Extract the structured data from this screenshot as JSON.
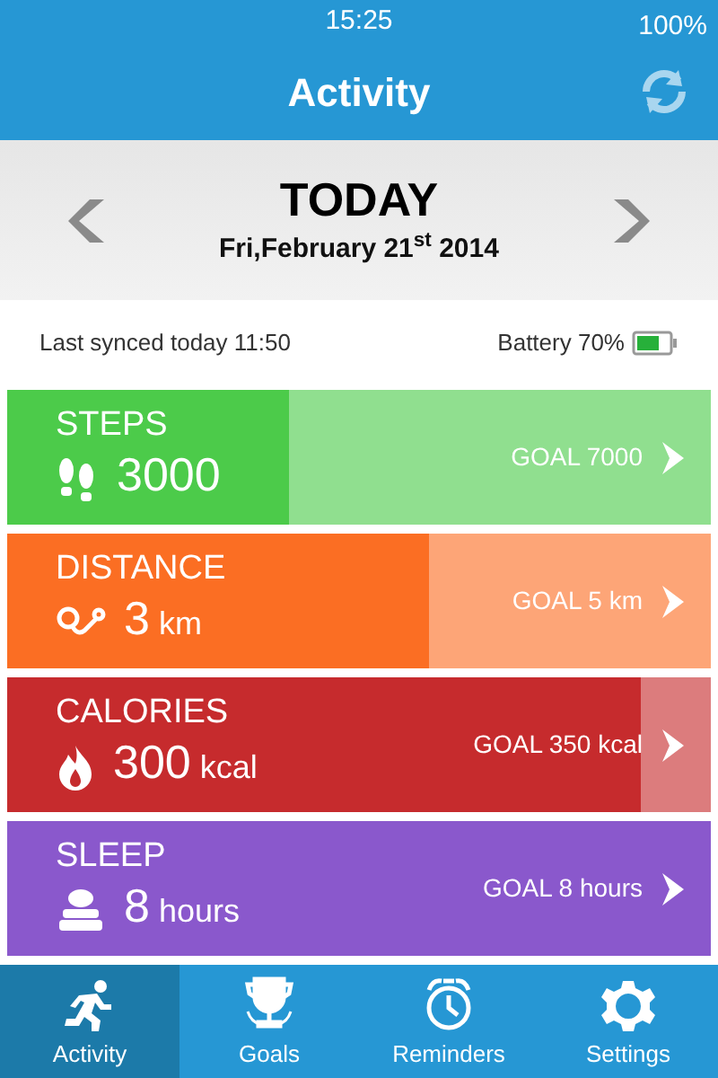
{
  "status_bar": {
    "time": "15:25",
    "battery": "100%"
  },
  "header": {
    "title": "Activity"
  },
  "date_nav": {
    "title": "TODAY",
    "date": "Fri,February 21$^{st}$ 2014"
  },
  "sync": {
    "last_synced": "Last synced today 11:50",
    "battery": "Battery 70%"
  },
  "cards": [
    {
      "kind": "steps",
      "label": "STEPS",
      "value": "3000",
      "goal": "GOAL 7000",
      "level": 0.4,
      "color": "#4ccb4a"
    },
    {
      "kind": "distance",
      "label": "DISTANCE",
      "value": "3",
      "unit": "km",
      "goal": "GOAL 5 km",
      "level": 0.6,
      "color": "#fb6e23"
    },
    {
      "kind": "calories",
      "label": "CALORIES",
      "value": "300",
      "unit": "kcal",
      "goal": "GOAL 350 kcal",
      "level": 0.9,
      "color": "#c62b2d"
    },
    {
      "kind": "sleep",
      "label": "SLEEP",
      "value": "8",
      "unit": "hours",
      "goal": "GOAL 8 hours",
      "level": 1,
      "color": "#8a58cc"
    }
  ],
  "tabs": [
    {
      "kind": "activity",
      "label": "Activity",
      "selected": true
    },
    {
      "kind": "goals",
      "label": "Goals",
      "selected": false
    },
    {
      "kind": "reminders",
      "label": "Reminders",
      "selected": false
    },
    {
      "kind": "settings",
      "label": "Settings",
      "selected": false
    }
  ]
}
